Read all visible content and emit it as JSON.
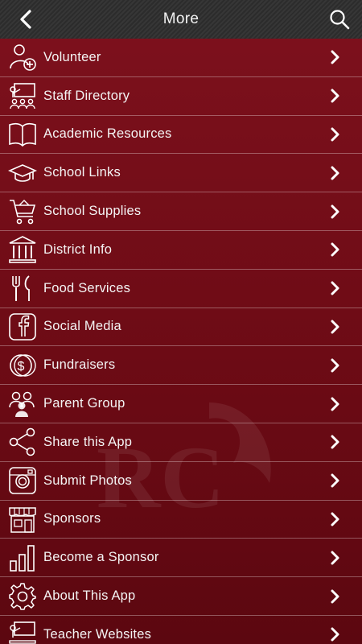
{
  "header": {
    "title": "More",
    "back_icon": "chevron-left-icon",
    "search_icon": "search-icon"
  },
  "colors": {
    "background": "#6d0b15",
    "header": "#303030",
    "text": "#ffffff"
  },
  "watermark_logo_text": "RC",
  "menu": [
    {
      "label": "Volunteer",
      "icon": "add-person-icon"
    },
    {
      "label": "Staff Directory",
      "icon": "classroom-icon"
    },
    {
      "label": "Academic Resources",
      "icon": "book-icon"
    },
    {
      "label": "School Links",
      "icon": "graduation-cap-icon"
    },
    {
      "label": "School Supplies",
      "icon": "shopping-cart-icon"
    },
    {
      "label": "District Info",
      "icon": "building-icon"
    },
    {
      "label": "Food Services",
      "icon": "fork-knife-icon"
    },
    {
      "label": "Social Media",
      "icon": "facebook-icon"
    },
    {
      "label": "Fundraisers",
      "icon": "coin-icon"
    },
    {
      "label": "Parent Group",
      "icon": "group-icon"
    },
    {
      "label": "Share this App",
      "icon": "share-icon"
    },
    {
      "label": "Submit Photos",
      "icon": "instagram-icon"
    },
    {
      "label": "Sponsors",
      "icon": "storefront-icon"
    },
    {
      "label": "Become a Sponsor",
      "icon": "bar-chart-icon"
    },
    {
      "label": "About This App",
      "icon": "gear-icon"
    },
    {
      "label": "Teacher Websites",
      "icon": "teacher-icon"
    }
  ]
}
